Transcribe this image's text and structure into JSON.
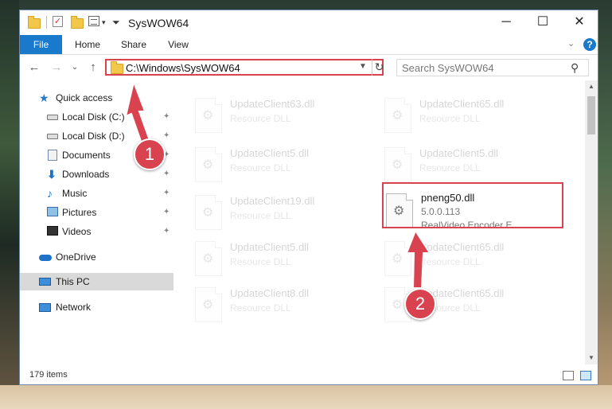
{
  "window": {
    "title": "SysWOW64",
    "min_symbol": "─",
    "max_symbol": "☐",
    "close_symbol": "✕"
  },
  "ribbon": {
    "tabs": [
      "File",
      "Home",
      "Share",
      "View"
    ],
    "help": "?",
    "expand_symbol": "⌄"
  },
  "nav": {
    "back": "←",
    "forward": "→",
    "recent": "⌄",
    "up": "↑",
    "address": "C:\\Windows\\SysWOW64",
    "refresh": "↻",
    "search_placeholder": "Search SysWOW64",
    "search_icon": "⚲"
  },
  "sidebar": {
    "items": [
      {
        "label": "Quick access",
        "icon": "star-icon",
        "pinned": false
      },
      {
        "label": "Local Disk (C:)",
        "icon": "drive-icon",
        "pinned": true
      },
      {
        "label": "Local Disk (D:)",
        "icon": "drive-icon",
        "pinned": true
      },
      {
        "label": "Documents",
        "icon": "documents-icon",
        "pinned": true
      },
      {
        "label": "Downloads",
        "icon": "downloads-icon",
        "pinned": true
      },
      {
        "label": "Music",
        "icon": "music-icon",
        "pinned": true
      },
      {
        "label": "Pictures",
        "icon": "pictures-icon",
        "pinned": true
      },
      {
        "label": "Videos",
        "icon": "videos-icon",
        "pinned": true
      },
      {
        "label": "OneDrive",
        "icon": "onedrive-icon",
        "pinned": false
      },
      {
        "label": "This PC",
        "icon": "this-pc-icon",
        "pinned": false,
        "selected": true
      },
      {
        "label": "Network",
        "icon": "network-icon",
        "pinned": false
      }
    ],
    "pin_symbol": "📌"
  },
  "files": [
    {
      "name": "UpdateClient63.dll",
      "type": "Resource DLL"
    },
    {
      "name": "UpdateClient65.dll",
      "type": "Resource DLL"
    },
    {
      "name": "UpdateClient5.dll",
      "type": "Resource DLL"
    },
    {
      "name": "UpdateClient5.dll",
      "type": "Resource DLL"
    },
    {
      "name": "UpdateClient19.dll",
      "type": "Resource DLL"
    },
    {
      "name": "pneng50.dll",
      "type": "5.0.0.113",
      "desc": "RealVideo Encoder E...",
      "highlighted": true
    },
    {
      "name": "UpdateClient5.dll",
      "type": "Resource DLL"
    },
    {
      "name": "UpdateClient65.dll",
      "type": "Resource DLL"
    },
    {
      "name": "UpdateClient8.dll",
      "type": "Resource DLL"
    },
    {
      "name": "UpdateClient65.dll",
      "type": "Resource DLL"
    }
  ],
  "status": {
    "item_count": "179 items"
  },
  "annotations": {
    "badge1": "1",
    "badge2": "2",
    "accent_color": "#d8434f"
  }
}
